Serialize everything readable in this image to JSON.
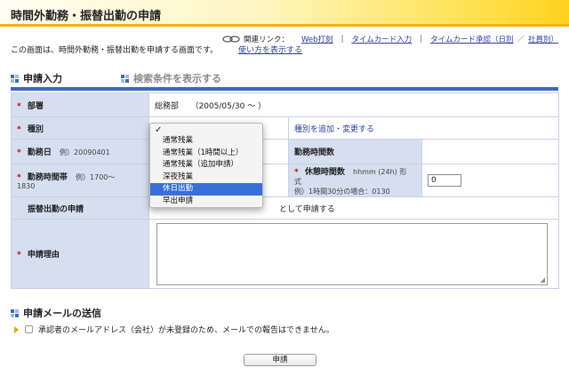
{
  "page": {
    "title": "時間外勤務・振替出勤の申請"
  },
  "related": {
    "label": "関連リンク：",
    "links": [
      "Web打刻",
      "タイムカード入力",
      "タイムカード承認（日別",
      "社員別）"
    ],
    "separators": [
      "|",
      "|",
      "／"
    ]
  },
  "intro": {
    "text": "この画面は、時間外勤務・振替出勤を申請する画面です。",
    "howto": "使い方を表示する"
  },
  "sections": {
    "input": "申請入力",
    "search": "検索条件を表示する",
    "mail": "申請メールの送信"
  },
  "form": {
    "req_mark": "*",
    "dept_label": "部署",
    "dept_value": "総務部　　（2005/05/30 〜 ）",
    "type_label": "種別",
    "type_link": "種別を追加・変更する",
    "date_label": "勤務日",
    "date_hint": "例）20090401",
    "hours_label": "勤務時間数",
    "timeband_label": "勤務時間帯",
    "timeband_hint": "例）1700〜",
    "timeband_hint2": "1830",
    "break_label": "休憩時間数",
    "break_format": "hhmm (24h) 形",
    "break_format2": "式",
    "break_example": "例）1時間30分の場合：0130",
    "break_value": "0",
    "furikae_label": "振替出勤の申請",
    "furikae_text": "として申請する",
    "reason_label": "申請理由"
  },
  "dropdown": {
    "check": "✓",
    "options": [
      "通常残業",
      "通常残業（1時間以上）",
      "通常残業（追加申請）",
      "深夜残業",
      "休日出勤",
      "早出申請"
    ],
    "selected": "休日出勤"
  },
  "mail": {
    "notice": "承認者のメールアドレス（会社）が未登録のため、メールでの報告はできません。"
  },
  "submit_label": "申請"
}
